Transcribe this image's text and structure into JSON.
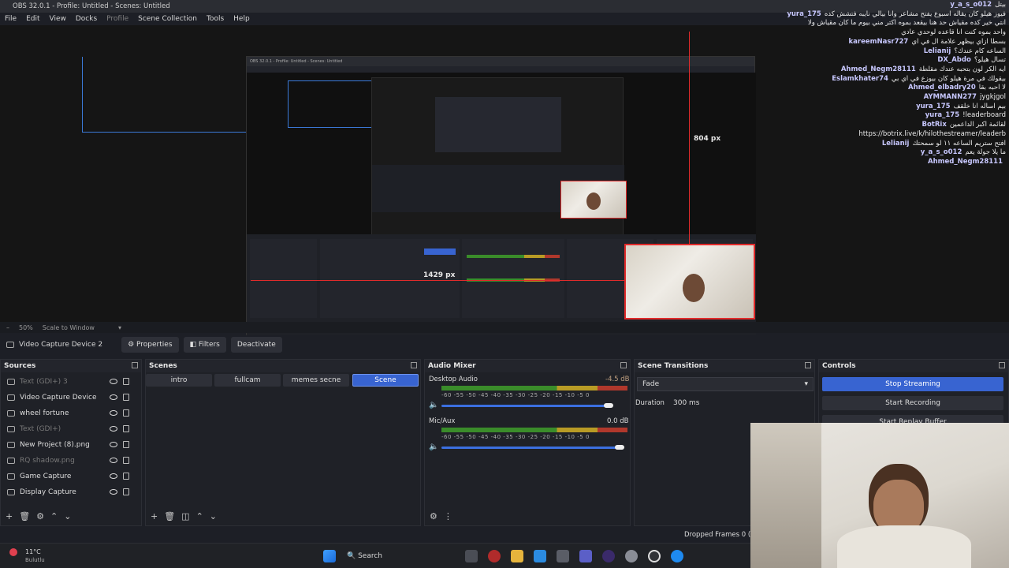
{
  "window": {
    "title": "OBS 32.0.1 - Profile: Untitled - Scenes: Untitled"
  },
  "menu": [
    "File",
    "Edit",
    "View",
    "Docks",
    "Profile",
    "Scene Collection",
    "Tools",
    "Help"
  ],
  "preview": {
    "width_label": "804 px",
    "height_label": "1429 px"
  },
  "chat": [
    {
      "user": "y_a_s_o012",
      "msg": "بيتل"
    },
    {
      "user": "yura_175",
      "msg": "فيوز هيلو كان يقاله اسبوع يفتح مشاعر وانا بيالي نايبه فتشش كده"
    },
    {
      "user": "",
      "msg": "انتي خير كده مقياش حد هنا بيقعد بموه اكتر مني بيوم ما كان مقياش ولا"
    },
    {
      "user": "",
      "msg": "واحد بموه كنت انا قاعده لوحدي عادي"
    },
    {
      "user": "kareemNasr727",
      "msg": "بسطا ازاي بيظهر علامة ال في اي"
    },
    {
      "user": "Lelianij",
      "msg": "الساعه كام عندك؟"
    },
    {
      "user": "DX_Abdo",
      "msg": "تسال هيلو؟"
    },
    {
      "user": "Ahmed_Negm28111",
      "msg": "ايه الكر لون بتحبه عندك مقلطة"
    },
    {
      "user": "Eslamkhater74",
      "msg": "بيقولك في مرة هيلو كان بيوزع في اي بي"
    },
    {
      "user": "Ahmed_elbadry20",
      "msg": "لا احبه بقا"
    },
    {
      "user": "AYMMANN277",
      "msg": "jygkjgol"
    },
    {
      "user": "yura_175",
      "msg": "بيم اساله انا خلقف"
    },
    {
      "user": "yura_175",
      "msg": "!leaderboard"
    },
    {
      "user": "BotRix",
      "msg": "لقائمة اكبر الداعمين"
    },
    {
      "user": "",
      "msg": "https://botrix.live/k/hilothestreamer/leaderb"
    },
    {
      "user": "Lelianij",
      "msg": "افتح ستريم الساعه ١١ لو سمحتك"
    },
    {
      "user": "y_a_s_o012",
      "msg": "ما يلا جولة يعم"
    },
    {
      "user": "Ahmed_Negm28111",
      "msg": ""
    }
  ],
  "zoom": {
    "percent": "50%",
    "mode": "Scale to Window"
  },
  "context": {
    "source_name": "Video Capture Device 2",
    "properties": "Properties",
    "filters": "Filters",
    "deactivate": "Deactivate"
  },
  "sources": {
    "title": "Sources",
    "items": [
      {
        "label": "Text (GDI+) 3",
        "dim": true
      },
      {
        "label": "Video Capture Device",
        "dim": false
      },
      {
        "label": "wheel fortune",
        "dim": false
      },
      {
        "label": "Text (GDI+)",
        "dim": true
      },
      {
        "label": "New Project (8).png",
        "dim": false
      },
      {
        "label": "RQ shadow.png",
        "dim": true
      },
      {
        "label": "Game Capture",
        "dim": false
      },
      {
        "label": "Display Capture",
        "dim": false
      }
    ]
  },
  "scenes": {
    "title": "Scenes",
    "items": [
      "intro",
      "fullcam",
      "memes secne",
      "Scene"
    ],
    "active": "Scene"
  },
  "mixer": {
    "title": "Audio Mixer",
    "channels": [
      {
        "name": "Desktop Audio",
        "db": "-4.5 dB",
        "level": 0.94
      },
      {
        "name": "Mic/Aux",
        "db": "0.0 dB",
        "level": 1.0
      }
    ],
    "ticks": "-60  -55  -50  -45  -40  -35  -30  -25  -20  -15  -10  -5  0"
  },
  "transitions": {
    "title": "Scene Transitions",
    "type": "Fade",
    "duration_label": "Duration",
    "duration": "300 ms"
  },
  "controls": {
    "title": "Controls",
    "stop_streaming": "Stop Streaming",
    "start_recording": "Start Recording",
    "replay": "Start Replay Buffer"
  },
  "status": {
    "dropped": "Dropped Frames 0 (0"
  },
  "taskbar": {
    "temp": "11°C",
    "weather": "Bulutlu",
    "search": "Search"
  }
}
